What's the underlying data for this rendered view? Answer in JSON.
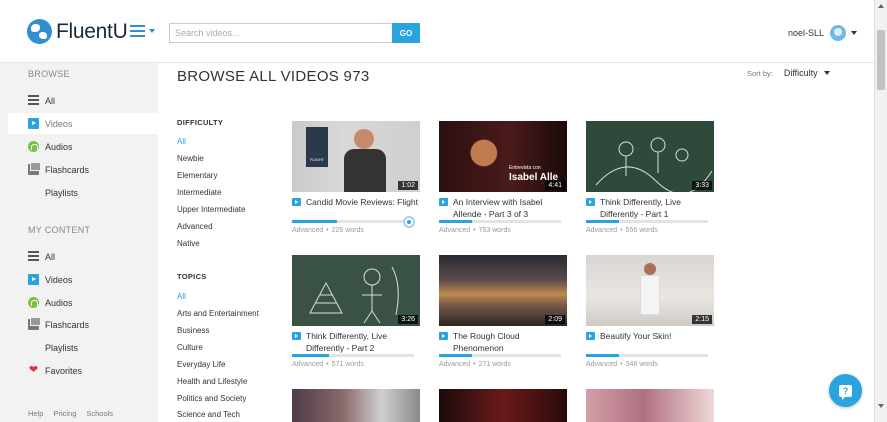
{
  "header": {
    "logo_text": "FluentU",
    "search_placeholder": "Search videos...",
    "go_label": "GO",
    "username": "noel-SLL"
  },
  "sidebar": {
    "browse_heading": "BROWSE",
    "browse_items": [
      {
        "label": "All",
        "icon": "list-icon"
      },
      {
        "label": "Videos",
        "icon": "video-icon"
      },
      {
        "label": "Audios",
        "icon": "audio-icon"
      },
      {
        "label": "Flashcards",
        "icon": "flashcards-icon"
      },
      {
        "label": "Playlists",
        "icon": "playlists-icon"
      }
    ],
    "content_heading": "MY CONTENT",
    "content_items": [
      {
        "label": "All",
        "icon": "list-icon"
      },
      {
        "label": "Videos",
        "icon": "video-icon"
      },
      {
        "label": "Audios",
        "icon": "audio-icon"
      },
      {
        "label": "Flashcards",
        "icon": "flashcards-icon"
      },
      {
        "label": "Playlists",
        "icon": "playlists-icon"
      },
      {
        "label": "Favorites",
        "icon": "heart-icon"
      }
    ],
    "footer_links": [
      "Help",
      "Pricing",
      "Schools"
    ]
  },
  "main": {
    "title": "BROWSE ALL VIDEOS 973",
    "sort_label": "Sort by:",
    "sort_value": "Difficulty"
  },
  "filters": {
    "difficulty_heading": "DIFFICULTY",
    "difficulty_items": [
      "All",
      "Newbie",
      "Elementary",
      "Intermediate",
      "Upper Intermediate",
      "Advanced",
      "Native"
    ],
    "topics_heading": "TOPICS",
    "topic_items": [
      "All",
      "Arts and Entertainment",
      "Business",
      "Culture",
      "Everyday Life",
      "Health and Lifestyle",
      "Politics and Society",
      "Science and Tech"
    ]
  },
  "videos": [
    {
      "title": "Candid Movie Reviews: Flight",
      "duration": "1:02",
      "level": "Advanced",
      "words": "225 words",
      "progress": 0.37
    },
    {
      "title": "An Interview with Isabel Allende - Part 3 of 3",
      "duration": "4:41",
      "level": "Advanced",
      "words": "753 words",
      "progress": 0.27
    },
    {
      "title": "Think Differently, Live Differently - Part 1",
      "duration": "3:33",
      "level": "Advanced",
      "words": "556 words",
      "progress": 0.27
    },
    {
      "title": "Think Differently, Live Differently - Part 2",
      "duration": "3:26",
      "level": "Advanced",
      "words": "571 words",
      "progress": 0.3
    },
    {
      "title": "The Rough Cloud Phenomenon",
      "duration": "2:09",
      "level": "Advanced",
      "words": "271 words",
      "progress": 0.27
    },
    {
      "title": "Beautify Your Skin!",
      "duration": "2:15",
      "level": "Advanced",
      "words": "348 words",
      "progress": 0.27
    }
  ],
  "thumb_text": {
    "movie_poster": "FLIGHT",
    "interview_caption": "Isabel Alle",
    "interview_small": "Entrevista con"
  },
  "colors": {
    "accent": "#2ba3e0",
    "sidebar_bg": "#f2f2f2"
  }
}
